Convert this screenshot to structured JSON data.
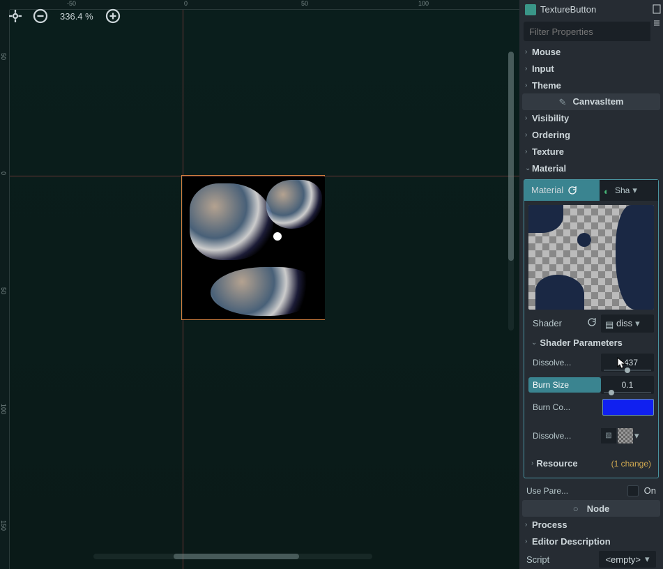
{
  "toolbar": {
    "zoom": "336.4 %"
  },
  "rulers": {
    "h": [
      "-50",
      "0",
      "50",
      "100"
    ],
    "v": [
      "50",
      "0",
      "50",
      "100",
      "150"
    ]
  },
  "inspector": {
    "node_type": "TextureButton",
    "filter_placeholder": "Filter Properties",
    "sections": {
      "mouse": "Mouse",
      "input": "Input",
      "theme": "Theme",
      "canvas_item": "CanvasItem",
      "visibility": "Visibility",
      "ordering": "Ordering",
      "texture": "Texture",
      "material": "Material",
      "process": "Process",
      "editor_desc": "Editor Description",
      "node": "Node"
    },
    "material": {
      "label": "Material",
      "shader_type": "Sha",
      "shader_label": "Shader",
      "shader_file": "diss",
      "params_label": "Shader Parameters",
      "params": {
        "dissolve": {
          "label": "Dissolve...",
          "value": "0.437",
          "slider_pct": 44
        },
        "burn_size": {
          "label": "Burn Size",
          "value": "0.1",
          "slider_pct": 10
        },
        "burn_color": {
          "label": "Burn Co...",
          "hex": "#1020f0"
        },
        "dissolve_tex": {
          "label": "Dissolve..."
        }
      },
      "resource": {
        "label": "Resource",
        "changes": "(1 change)"
      }
    },
    "use_parent": {
      "label": "Use Pare...",
      "on": "On"
    },
    "script": {
      "label": "Script",
      "value": "<empty>"
    }
  }
}
